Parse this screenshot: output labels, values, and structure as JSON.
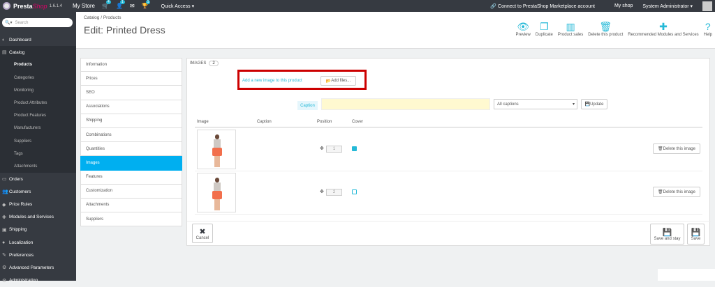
{
  "topbar": {
    "brand": "Presta",
    "brand_italic": "Shop",
    "version": "1.6.1.4",
    "store": "My Store",
    "cart_badge": "4",
    "customers_badge": "1",
    "trophy_badge": "1",
    "quick_access": "Quick Access ▾",
    "marketplace": "Connect to PrestaShop Marketplace account",
    "my_shop": "My shop",
    "admin": "System Administrator ▾"
  },
  "sidebar": {
    "search_placeholder": "Search",
    "items": [
      {
        "label": "Dashboard",
        "icon": "dashboard-icon",
        "glyph": "◐"
      },
      {
        "label": "Catalog",
        "icon": "catalog-icon",
        "glyph": "▤"
      },
      {
        "label": "Orders",
        "icon": "orders-icon",
        "glyph": "▭"
      },
      {
        "label": "Customers",
        "icon": "customers-icon",
        "glyph": "👥"
      },
      {
        "label": "Price Rules",
        "icon": "price-rules-icon",
        "glyph": "◆"
      },
      {
        "label": "Modules and Services",
        "icon": "modules-icon",
        "glyph": "✚"
      },
      {
        "label": "Shipping",
        "icon": "shipping-icon",
        "glyph": "▣"
      },
      {
        "label": "Localization",
        "icon": "localization-icon",
        "glyph": "●"
      },
      {
        "label": "Preferences",
        "icon": "preferences-icon",
        "glyph": "✎"
      },
      {
        "label": "Advanced Parameters",
        "icon": "advanced-icon",
        "glyph": "⚙"
      },
      {
        "label": "Administration",
        "icon": "administration-icon",
        "glyph": "⚙"
      }
    ],
    "catalog_sub": [
      "Products",
      "Categories",
      "Monitoring",
      "Product Attributes",
      "Product Features",
      "Manufacturers",
      "Suppliers",
      "Tags",
      "Attachments"
    ]
  },
  "header": {
    "breadcrumb": "Catalog  /  Products",
    "title": "Edit: Printed Dress",
    "tools": [
      {
        "label": "Preview",
        "icon": "preview-icon",
        "glyph": "👁"
      },
      {
        "label": "Duplicate",
        "icon": "duplicate-icon",
        "glyph": "❐"
      },
      {
        "label": "Product sales",
        "icon": "product-sales-icon",
        "glyph": "▥"
      },
      {
        "label": "Delete this product",
        "icon": "trash-icon",
        "glyph": "🗑"
      },
      {
        "label": "Recommended Modules and Services",
        "icon": "puzzle-icon",
        "glyph": "✚"
      },
      {
        "label": "Help",
        "icon": "help-icon",
        "glyph": "?"
      }
    ]
  },
  "tabs": [
    "Information",
    "Prices",
    "SEO",
    "Associations",
    "Shipping",
    "Combinations",
    "Quantities",
    "Images",
    "Features",
    "Customization",
    "Attachments",
    "Suppliers"
  ],
  "images_panel": {
    "heading": "IMAGES",
    "count": "2",
    "add_link": "Add a new image to this product",
    "add_files": "Add files...",
    "caption_label": "Caption",
    "caption_value": "",
    "caption_select": "All captions",
    "update": "Update",
    "columns": {
      "image": "Image",
      "caption": "Caption",
      "position": "Position",
      "cover": "Cover"
    },
    "rows": [
      {
        "position": "1",
        "cover": true,
        "delete": "Delete this image"
      },
      {
        "position": "2",
        "cover": false,
        "delete": "Delete this image"
      }
    ],
    "cancel": "Cancel",
    "save_stay": "Save and stay",
    "save": "Save"
  }
}
